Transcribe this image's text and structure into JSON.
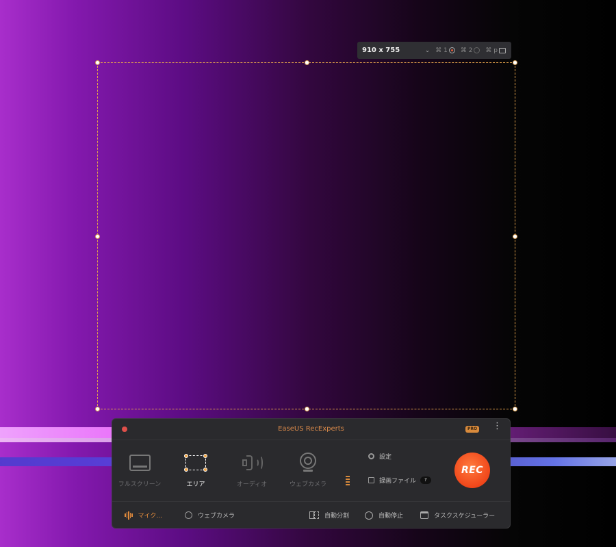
{
  "selection": {
    "size_label": "910 x 755",
    "shortcut_record": "⌘ 1",
    "shortcut_stop": "⌘ 2",
    "shortcut_screenshot": "⌘ p"
  },
  "panel": {
    "title": "EaseUS RecExperts",
    "pro_badge": "PRO",
    "more_glyph": "⋮",
    "modes": [
      {
        "label": "フルスクリーン",
        "icon": "monitor-icon",
        "active": false
      },
      {
        "label": "エリア",
        "icon": "area-select-icon",
        "active": true
      },
      {
        "label": "オーディオ",
        "icon": "speaker-icon",
        "active": false
      },
      {
        "label": "ウェブカメラ",
        "icon": "webcam-icon",
        "active": false
      }
    ],
    "settings_label": "設定",
    "recordings_label": "録画ファイル",
    "recordings_badge": "?",
    "rec_label": "REC",
    "bottom": {
      "mic_label": "マイク...",
      "webcam_label": "ウェブカメラ",
      "auto_split_label": "自動分割",
      "auto_stop_label": "自動停止",
      "scheduler_label": "タスクスケジューラー"
    }
  },
  "colors": {
    "accent": "#e08a3c",
    "rec": "#f0461a"
  }
}
